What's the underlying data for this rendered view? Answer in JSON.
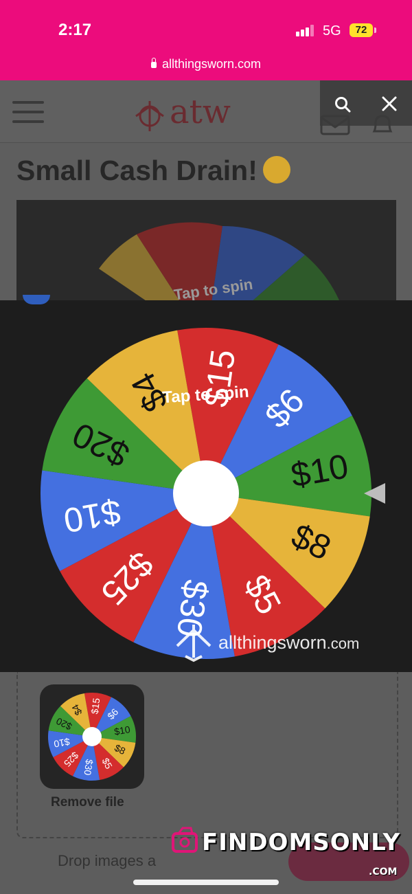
{
  "status_bar": {
    "time": "2:17",
    "network": "5G",
    "battery": "72"
  },
  "browser": {
    "url": "allthingsworn.com"
  },
  "site": {
    "logo_text": "atw",
    "page_title": "Small Cash Drain!"
  },
  "wheel": {
    "center_label": "Tap to spin",
    "watermark_brand": "allthingsworn",
    "watermark_tld": ".com",
    "segments": [
      {
        "label": "$15",
        "color": "#d42d2d"
      },
      {
        "label": "$6",
        "color": "#4470e0"
      },
      {
        "label": "$10",
        "color": "#3e9a35"
      },
      {
        "label": "$8",
        "color": "#e6b43a"
      },
      {
        "label": "$5",
        "color": "#d42d2d"
      },
      {
        "label": "$30",
        "color": "#4470e0"
      },
      {
        "label": "$25",
        "color": "#d42d2d"
      },
      {
        "label": "$10",
        "color": "#4470e0"
      },
      {
        "label": "$20",
        "color": "#3e9a35"
      },
      {
        "label": "$4",
        "color": "#e6b43a"
      }
    ]
  },
  "upload": {
    "remove_label": "Remove file",
    "drop_text": "Drop images a"
  },
  "watermark": {
    "text": "FINDOMSONLY",
    "sub": ".COM"
  }
}
